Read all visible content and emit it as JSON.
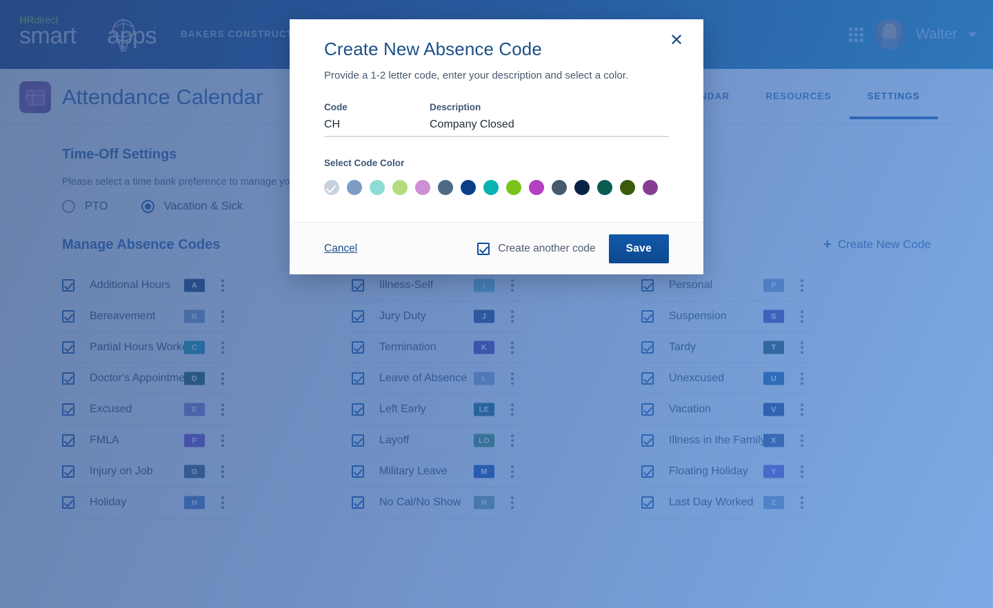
{
  "topbar": {
    "logo_hr": "HR",
    "logo_direct": "direct",
    "logo_smart": "smart",
    "logo_apps": "apps",
    "company": "BAKERS CONSTRUCTION",
    "grid_icon": "apps-grid-icon",
    "avatar_alt": "user-avatar",
    "username": "Walter",
    "caret_icon": "chevron-down-icon"
  },
  "pagehead": {
    "app_icon": "calendar-app-icon",
    "title": "Attendance Calendar",
    "tabs": [
      {
        "label": "CALENDAR",
        "active": false
      },
      {
        "label": "RESOURCES",
        "active": false
      },
      {
        "label": "SETTINGS",
        "active": true
      }
    ]
  },
  "timeoff": {
    "title": "Time-Off Settings",
    "description": "Please select a time bank preference to manage your time-off.",
    "options": [
      {
        "label": "PTO",
        "selected": false
      },
      {
        "label": "Vacation & Sick",
        "selected": true
      }
    ]
  },
  "manage_codes": {
    "title": "Manage Absence Codes",
    "create_new_label": "Create New Code",
    "create_new_icon": "plus-icon",
    "columns": [
      [
        {
          "name": "Additional Hours",
          "code": "A",
          "color": "#10305e",
          "checked": true
        },
        {
          "name": "Bereavement",
          "code": "B",
          "color": "#8099bf",
          "checked": true
        },
        {
          "name": "Partial Hours Worked",
          "code": "C",
          "color": "#0d9aa0",
          "checked": true
        },
        {
          "name": "Doctor's Appointment",
          "code": "D",
          "color": "#1b5243",
          "checked": true
        },
        {
          "name": "Excused",
          "code": "E",
          "color": "#8e76c4",
          "checked": true
        },
        {
          "name": "FMLA",
          "code": "F",
          "color": "#7b3fc4",
          "checked": true
        },
        {
          "name": "Injury on Job",
          "code": "G",
          "color": "#3d5670",
          "checked": true
        },
        {
          "name": "Holiday",
          "code": "H",
          "color": "#4a76bb",
          "checked": true
        }
      ],
      [
        {
          "name": "Illness-Self",
          "code": "I",
          "color": "#69c2cf",
          "checked": true
        },
        {
          "name": "Jury Duty",
          "code": "J",
          "color": "#1d3f73",
          "checked": true
        },
        {
          "name": "Termination",
          "code": "K",
          "color": "#4b2fa8",
          "checked": true
        },
        {
          "name": "Leave of Absence",
          "code": "L",
          "color": "#8fa8c9",
          "checked": true
        },
        {
          "name": "Left Early",
          "code": "LE",
          "color": "#0d5f6e",
          "checked": true
        },
        {
          "name": "Layoff",
          "code": "LO",
          "color": "#3f8c5c",
          "checked": true
        },
        {
          "name": "Military Leave",
          "code": "M",
          "color": "#0b44a8",
          "checked": true
        },
        {
          "name": "No Cal/No Show",
          "code": "N",
          "color": "#6fa391",
          "checked": true
        }
      ],
      [
        {
          "name": "Personal",
          "code": "P",
          "color": "#7e9cc7",
          "checked": true
        },
        {
          "name": "Suspension",
          "code": "S",
          "color": "#4f36b5",
          "checked": true
        },
        {
          "name": "Tardy",
          "code": "T",
          "color": "#1e4a4f",
          "checked": true
        },
        {
          "name": "Unexcused",
          "code": "U",
          "color": "#1256a0",
          "checked": true
        },
        {
          "name": "Vacation",
          "code": "V",
          "color": "#12337f",
          "checked": true
        },
        {
          "name": "Illness in the Family",
          "code": "X",
          "color": "#2e4c94",
          "checked": true
        },
        {
          "name": "Floating Holiday",
          "code": "Y",
          "color": "#5b4bd6",
          "checked": true
        },
        {
          "name": "Last Day Worked",
          "code": "Z",
          "color": "#7e9cc7",
          "checked": true
        }
      ]
    ]
  },
  "modal": {
    "title": "Create New Absence Code",
    "subtitle": "Provide a 1-2 letter code, enter your description and select a color.",
    "close_icon": "close-icon",
    "code_label": "Code",
    "code_value": "CH",
    "code_placeholder": "",
    "description_label": "Description",
    "description_value": "Company Closed",
    "description_placeholder": "",
    "color_label": "Select Code Color",
    "colors": [
      {
        "hex": "#c7d1dd",
        "selected": true
      },
      {
        "hex": "#7d9cc4",
        "selected": false
      },
      {
        "hex": "#8bdcd5",
        "selected": false
      },
      {
        "hex": "#b4db7d",
        "selected": false
      },
      {
        "hex": "#cf8fd6",
        "selected": false
      },
      {
        "hex": "#4d6b85",
        "selected": false
      },
      {
        "hex": "#0a3f87",
        "selected": false
      },
      {
        "hex": "#07b3ae",
        "selected": false
      },
      {
        "hex": "#7ac41a",
        "selected": false
      },
      {
        "hex": "#b43ec4",
        "selected": false
      },
      {
        "hex": "#475a6b",
        "selected": false
      },
      {
        "hex": "#0a2342",
        "selected": false
      },
      {
        "hex": "#0a5c51",
        "selected": false
      },
      {
        "hex": "#3c5a0b",
        "selected": false
      },
      {
        "hex": "#84408f",
        "selected": false
      }
    ],
    "cancel_label": "Cancel",
    "another_label": "Create another code",
    "another_checked": true,
    "save_label": "Save"
  }
}
